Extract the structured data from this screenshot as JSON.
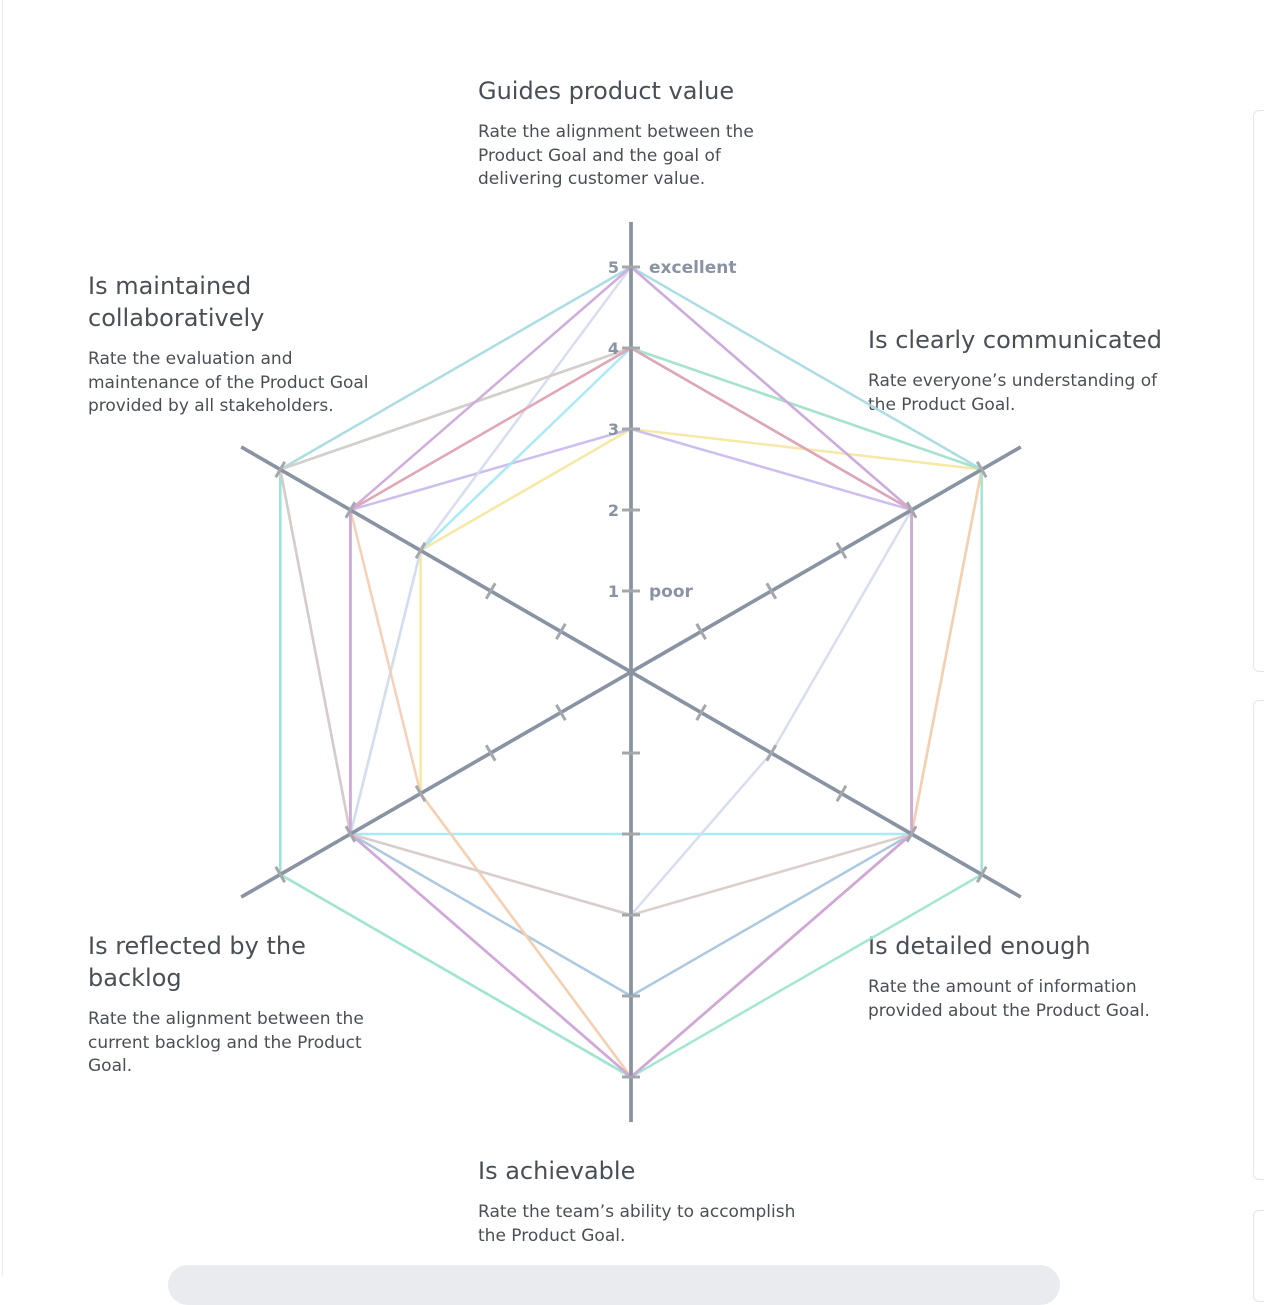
{
  "dimensions": [
    {
      "title": "Guides product value",
      "desc": "Rate the alignment between the Product Goal and the goal of delivering customer value."
    },
    {
      "title": "Is clearly communicated",
      "desc": "Rate everyone’s understanding of the Product Goal."
    },
    {
      "title": "Is detailed enough",
      "desc": "Rate the amount of information provided about the Product Goal."
    },
    {
      "title": "Is achievable",
      "desc": "Rate the team’s ability to accomplish the Product Goal."
    },
    {
      "title": "Is reflected by the backlog",
      "desc": "Rate the alignment between the current backlog and the Product Goal."
    },
    {
      "title": "Is maintained collaboratively",
      "desc": "Rate the evaluation and maintenance of the Product Goal provided by all stakeholders."
    }
  ],
  "scale": {
    "max_label": "excellent",
    "min_label": "poor"
  },
  "chart_data": {
    "type": "radar",
    "axes": [
      "Guides product value",
      "Is clearly communicated",
      "Is detailed enough",
      "Is achievable",
      "Is reflected by the backlog",
      "Is maintained collaboratively"
    ],
    "range": [
      0,
      5
    ],
    "ticks": [
      "1",
      "2",
      "3",
      "4",
      "5"
    ],
    "series": [
      {
        "color": "#a8dae3",
        "values": [
          5,
          5,
          4,
          5,
          5,
          5
        ]
      },
      {
        "color": "#a8c6df",
        "values": [
          4,
          4,
          4,
          4,
          4,
          5
        ]
      },
      {
        "color": "#f7e7a0",
        "values": [
          3,
          5,
          4,
          5,
          3,
          3
        ]
      },
      {
        "color": "#c9bbee",
        "values": [
          3,
          4,
          4,
          5,
          4,
          4
        ]
      },
      {
        "color": "#a5e9f5",
        "values": [
          4,
          4,
          4,
          2,
          4,
          3
        ]
      },
      {
        "color": "#d6dcef",
        "values": [
          5,
          4,
          2,
          3,
          4,
          3
        ]
      },
      {
        "color": "#f5cdb3",
        "values": [
          4,
          5,
          4,
          5,
          3,
          4
        ]
      },
      {
        "color": "#9ee5cf",
        "values": [
          4,
          5,
          5,
          5,
          5,
          5
        ]
      },
      {
        "color": "#d9ccc9",
        "values": [
          4,
          4,
          4,
          3,
          4,
          5
        ]
      },
      {
        "color": "#dfa3b6",
        "values": [
          4,
          4,
          4,
          5,
          4,
          4
        ]
      },
      {
        "color": "#cfa8da",
        "values": [
          5,
          4,
          4,
          5,
          4,
          4
        ]
      }
    ]
  }
}
